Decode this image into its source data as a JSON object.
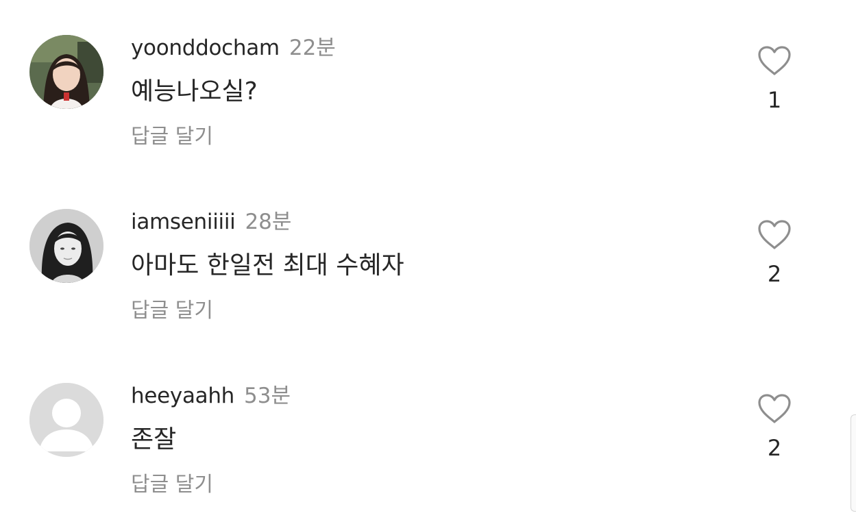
{
  "comments": [
    {
      "username": "yoonddocham",
      "time": "22분",
      "text": "예능나오실?",
      "reply_label": "답글 달기",
      "like_count": "1",
      "avatar": "girl-photo"
    },
    {
      "username": "iamseniiiii",
      "time": "28분",
      "text": "아마도 한일전 최대 수혜자",
      "reply_label": "답글 달기",
      "like_count": "2",
      "avatar": "bw-portrait-photo"
    },
    {
      "username": "heeyaahh",
      "time": "53분",
      "text": "존잘",
      "reply_label": "답글 달기",
      "like_count": "2",
      "avatar": "default-user-icon"
    }
  ],
  "colors": {
    "text_primary": "#262626",
    "text_secondary": "#8e8e8e",
    "heart_outline": "#8e8e8e",
    "default_avatar_bg": "#dbdbdb"
  }
}
